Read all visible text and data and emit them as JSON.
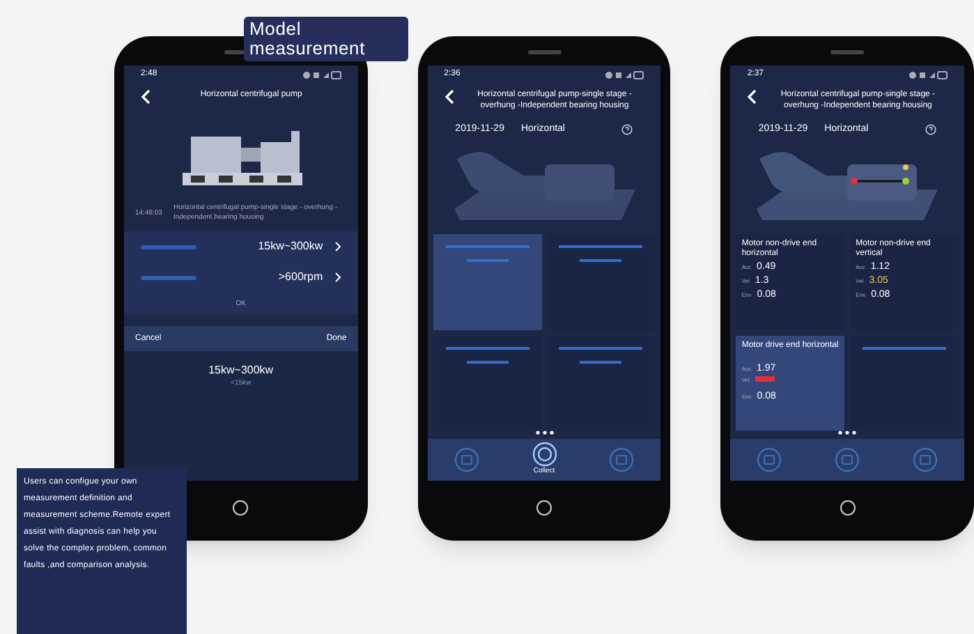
{
  "caption_top": "Model measurement",
  "caption_bottom": "Users can configue your own measurement definition and measurement scheme.Remote expert assist with diagnosis can help you solve the complex problem, common faults ,and comparison analysis.",
  "phones": [
    {
      "kind": "settings",
      "status_time": "2:48",
      "title": "Horizontal centrifugal pump",
      "record": {
        "time": "14:48:03",
        "description": "Horizontal centrifugal pump-single stage - overhung -Independent bearing housing"
      },
      "rows": [
        {
          "value": "15kw~300kw"
        },
        {
          "value": ">600rpm"
        }
      ],
      "confirm": "OK",
      "picker": {
        "cancel": "Cancel",
        "done": "Done",
        "options": [
          {
            "label": "15kw~300kw",
            "selected": true
          },
          {
            "label": "<15kw",
            "selected": false
          }
        ]
      }
    },
    {
      "kind": "points",
      "status_time": "2:36",
      "title": "Horizontal centrifugal pump-single stage - overhung -Independent bearing housing",
      "date": "2019-11-29",
      "orientation": "Horizontal",
      "cards": [
        {
          "selected": true
        },
        {
          "selected": false
        },
        {
          "selected": false
        },
        {
          "selected": false
        }
      ],
      "nav": [
        {
          "selected": false
        },
        {
          "label": "Collect",
          "selected": true
        },
        {
          "selected": false
        }
      ]
    },
    {
      "kind": "readings",
      "status_time": "2:37",
      "title": "Horizontal centrifugal pump-single stage - overhung -Independent bearing housing",
      "date": "2019-11-29",
      "orientation": "Horizontal",
      "cards": [
        {
          "name": "Motor non-drive end horizontal",
          "selected": false,
          "readings": [
            {
              "label": "Acc",
              "value": "0.49",
              "color": "#ffffff"
            },
            {
              "label": "Vel",
              "value": "1.3",
              "color": "#ffffff"
            },
            {
              "label": "Env",
              "value": "0.08",
              "color": "#ffffff"
            }
          ]
        },
        {
          "name": "Motor non-drive end vertical",
          "selected": false,
          "readings": [
            {
              "label": "Acc",
              "value": "1.12",
              "color": "#ffffff"
            },
            {
              "label": "Vel",
              "value": "3.05",
              "color": "#e8d13a"
            },
            {
              "label": "Env",
              "value": "0.08",
              "color": "#ffffff"
            }
          ]
        },
        {
          "name": "Motor drive end horizontal",
          "selected": true,
          "readings": [
            {
              "label": "Acc",
              "value": "1.97",
              "color": "#ffffff"
            },
            {
              "label": "Vel",
              "color": "#e0303a"
            },
            {
              "label": "Env",
              "value": "0.08",
              "color": "#ffffff"
            }
          ]
        },
        {
          "selected": false
        }
      ],
      "nav": [
        {
          "selected": false
        },
        {
          "selected": false
        },
        {
          "selected": false
        }
      ]
    }
  ]
}
